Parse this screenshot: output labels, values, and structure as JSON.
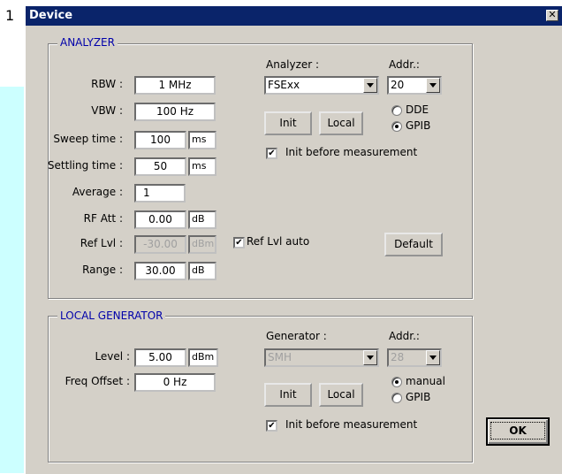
{
  "page_number": "1",
  "window": {
    "title": "Device",
    "close_glyph": "✕"
  },
  "analyzer": {
    "group_title": "ANALYZER",
    "rbw": {
      "label": "RBW :",
      "value": "1 MHz"
    },
    "vbw": {
      "label": "VBW :",
      "value": "100  Hz"
    },
    "sweep_time": {
      "label": "Sweep time :",
      "value": "100",
      "unit": "ms"
    },
    "settling_time": {
      "label": "Settling time :",
      "value": "50",
      "unit": "ms"
    },
    "average": {
      "label": "Average :",
      "value": "1"
    },
    "rf_att": {
      "label": "RF Att :",
      "value": "0.00",
      "unit": "dB"
    },
    "ref_lvl": {
      "label": "Ref Lvl :",
      "value": "-30.00",
      "unit": "dBm",
      "disabled": true
    },
    "ref_lvl_auto": {
      "label": "Ref Lvl auto",
      "checked": true
    },
    "range": {
      "label": "Range :",
      "value": "30.00",
      "unit": "dB"
    },
    "instrument_label": "Analyzer :",
    "instrument_value": "FSExx",
    "addr_label": "Addr.:",
    "addr_value": "20",
    "init_button": "Init",
    "local_button": "Local",
    "radio_dde": "DDE",
    "radio_gpib": "GPIB",
    "selected_interface": "GPIB",
    "init_before_measurement": {
      "label": "Init before measurement",
      "checked": true
    },
    "default_button": "Default"
  },
  "local_generator": {
    "group_title": "LOCAL GENERATOR",
    "level": {
      "label": "Level :",
      "value": "5.00",
      "unit": "dBm"
    },
    "freq_offset": {
      "label": "Freq Offset :",
      "value": "0  Hz"
    },
    "instrument_label": "Generator :",
    "instrument_value": "SMH",
    "addr_label": "Addr.:",
    "addr_value": "28",
    "init_button": "Init",
    "local_button": "Local",
    "radio_manual": "manual",
    "radio_gpib": "GPIB",
    "selected_interface": "manual",
    "init_before_measurement": {
      "label": "Init before measurement",
      "checked": true
    }
  },
  "ok_button": "OK",
  "check_glyph": "✔"
}
